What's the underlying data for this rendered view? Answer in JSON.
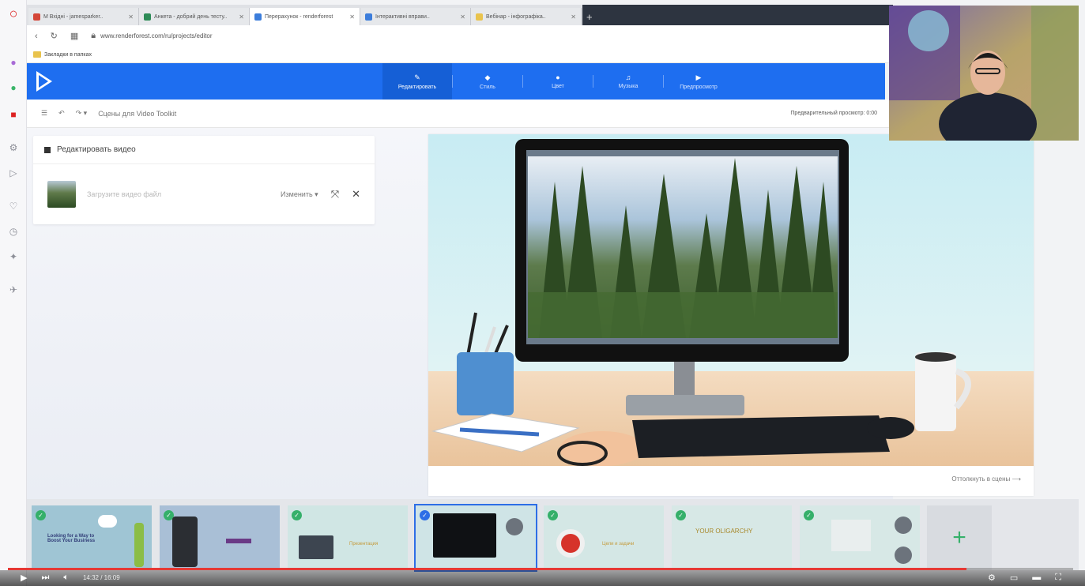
{
  "browser": {
    "tabs": [
      {
        "label": "M Вхідні - jamesparker..",
        "color": "#d44638",
        "active": false
      },
      {
        "label": "Анкета - добрий день тесту..",
        "color": "#2e8b57",
        "active": false
      },
      {
        "label": "Перерахунок - renderforest",
        "color": "#f0f0f0",
        "active": true
      },
      {
        "label": "Інтерактивні вправи..",
        "color": "#3c7ddb",
        "active": false
      },
      {
        "label": "Вебінар - інфографіка..",
        "color": "#e9c34d",
        "active": false
      }
    ],
    "new_tab": "+",
    "url": "www.renderforest.com/ru/projects/editor",
    "bookmark": "Закладки в папках"
  },
  "app": {
    "steps": [
      {
        "label": "Редактировать",
        "icon": "✎",
        "active": true
      },
      {
        "label": "Стиль",
        "icon": "◆",
        "active": false
      },
      {
        "label": "Цвет",
        "icon": "●",
        "active": false
      },
      {
        "label": "Музыка",
        "icon": "♫",
        "active": false
      },
      {
        "label": "Предпросмотр",
        "icon": "▶",
        "active": false
      }
    ],
    "toolbar": {
      "menu": "☰",
      "undo": "↶",
      "redo": "↷ ▾",
      "project_name": "Сцены для Video Toolkit",
      "hint": "Предварительный просмотр: 0:00"
    },
    "panel": {
      "title": "Редактировать видео",
      "filename": "Загрузите видео файл",
      "mode": "Изменить",
      "crop_icon": "⤧",
      "close_icon": "✕"
    },
    "preview": {
      "caption": "Оттолкнуть в сцены"
    },
    "timeline": {
      "slides": [
        {
          "text": "Looking for a Way to Boost Your Business",
          "selected": false
        },
        {
          "text": "",
          "selected": false
        },
        {
          "text": "Презентация",
          "selected": false
        },
        {
          "text": "",
          "selected": true
        },
        {
          "text": "Цели и задачи",
          "selected": false
        },
        {
          "text": "YOUR OLIGARCHY",
          "selected": false
        },
        {
          "text": "",
          "selected": false
        }
      ],
      "add_label": "+"
    }
  },
  "video": {
    "progress_fraction": 0.9,
    "time": "14:32 / 16:09"
  },
  "colors": {
    "accent": "#1e6ef0",
    "check": "#35b06a",
    "progress": "#e53935"
  }
}
